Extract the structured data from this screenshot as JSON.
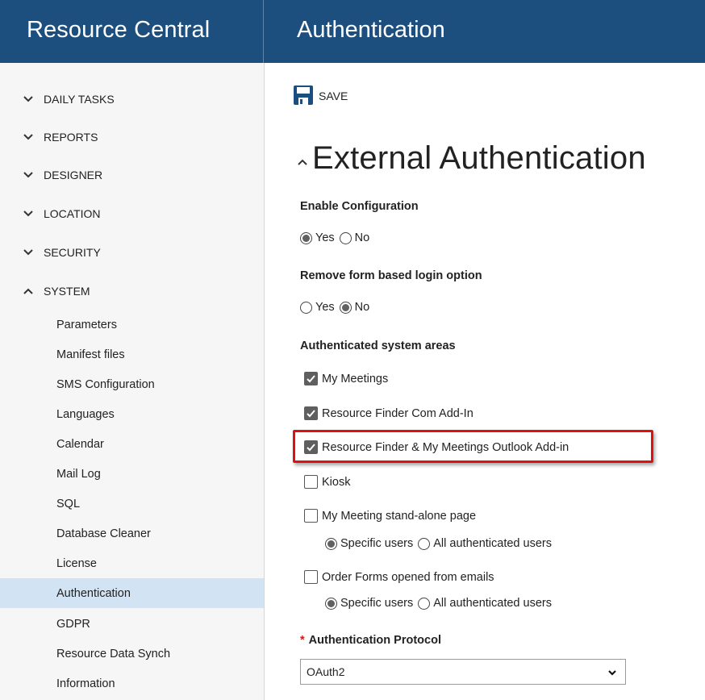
{
  "app": {
    "title": "Resource Central"
  },
  "page": {
    "title": "Authentication"
  },
  "toolbar": {
    "save_label": "SAVE"
  },
  "sidebar": {
    "sections": [
      {
        "label": "DAILY TASKS",
        "expanded": false
      },
      {
        "label": "REPORTS",
        "expanded": false
      },
      {
        "label": "DESIGNER",
        "expanded": false
      },
      {
        "label": "LOCATION",
        "expanded": false
      },
      {
        "label": "SECURITY",
        "expanded": false
      },
      {
        "label": "SYSTEM",
        "expanded": true
      }
    ],
    "system_items": [
      "Parameters",
      "Manifest files",
      "SMS Configuration",
      "Languages",
      "Calendar",
      "Mail Log",
      "SQL",
      "Database Cleaner",
      "License",
      "Authentication",
      "GDPR",
      "Resource Data Synch",
      "Information"
    ],
    "active_item": "Authentication"
  },
  "form": {
    "section_title": "External Authentication",
    "enable_configuration": {
      "label": "Enable Configuration",
      "options": [
        "Yes",
        "No"
      ],
      "selected": "Yes"
    },
    "remove_form_login": {
      "label": "Remove form based login option",
      "options": [
        "Yes",
        "No"
      ],
      "selected": "No"
    },
    "areas": {
      "label": "Authenticated system areas",
      "items": [
        {
          "label": "My Meetings",
          "checked": true
        },
        {
          "label": "Resource Finder Com Add-In",
          "checked": true
        },
        {
          "label": "Resource Finder & My Meetings Outlook Add-in",
          "checked": true
        },
        {
          "label": "Kiosk",
          "checked": false
        },
        {
          "label": "My Meeting stand-alone page",
          "checked": false
        },
        {
          "label": "Order Forms opened from emails",
          "checked": false
        }
      ],
      "user_scope_options": [
        "Specific users",
        "All authenticated users"
      ],
      "standalone_scope_selected": "Specific users",
      "order_forms_scope_selected": "Specific users"
    },
    "protocol": {
      "required_mark": "*",
      "label": "Authentication Protocol",
      "selected": "OAuth2"
    }
  },
  "colors": {
    "header_bg": "#1c4e7e",
    "sidebar_bg": "#f6f6f6",
    "active_item_bg": "#d2e4f4",
    "highlight_border": "#e01010",
    "required_star": "#d01a1a"
  }
}
